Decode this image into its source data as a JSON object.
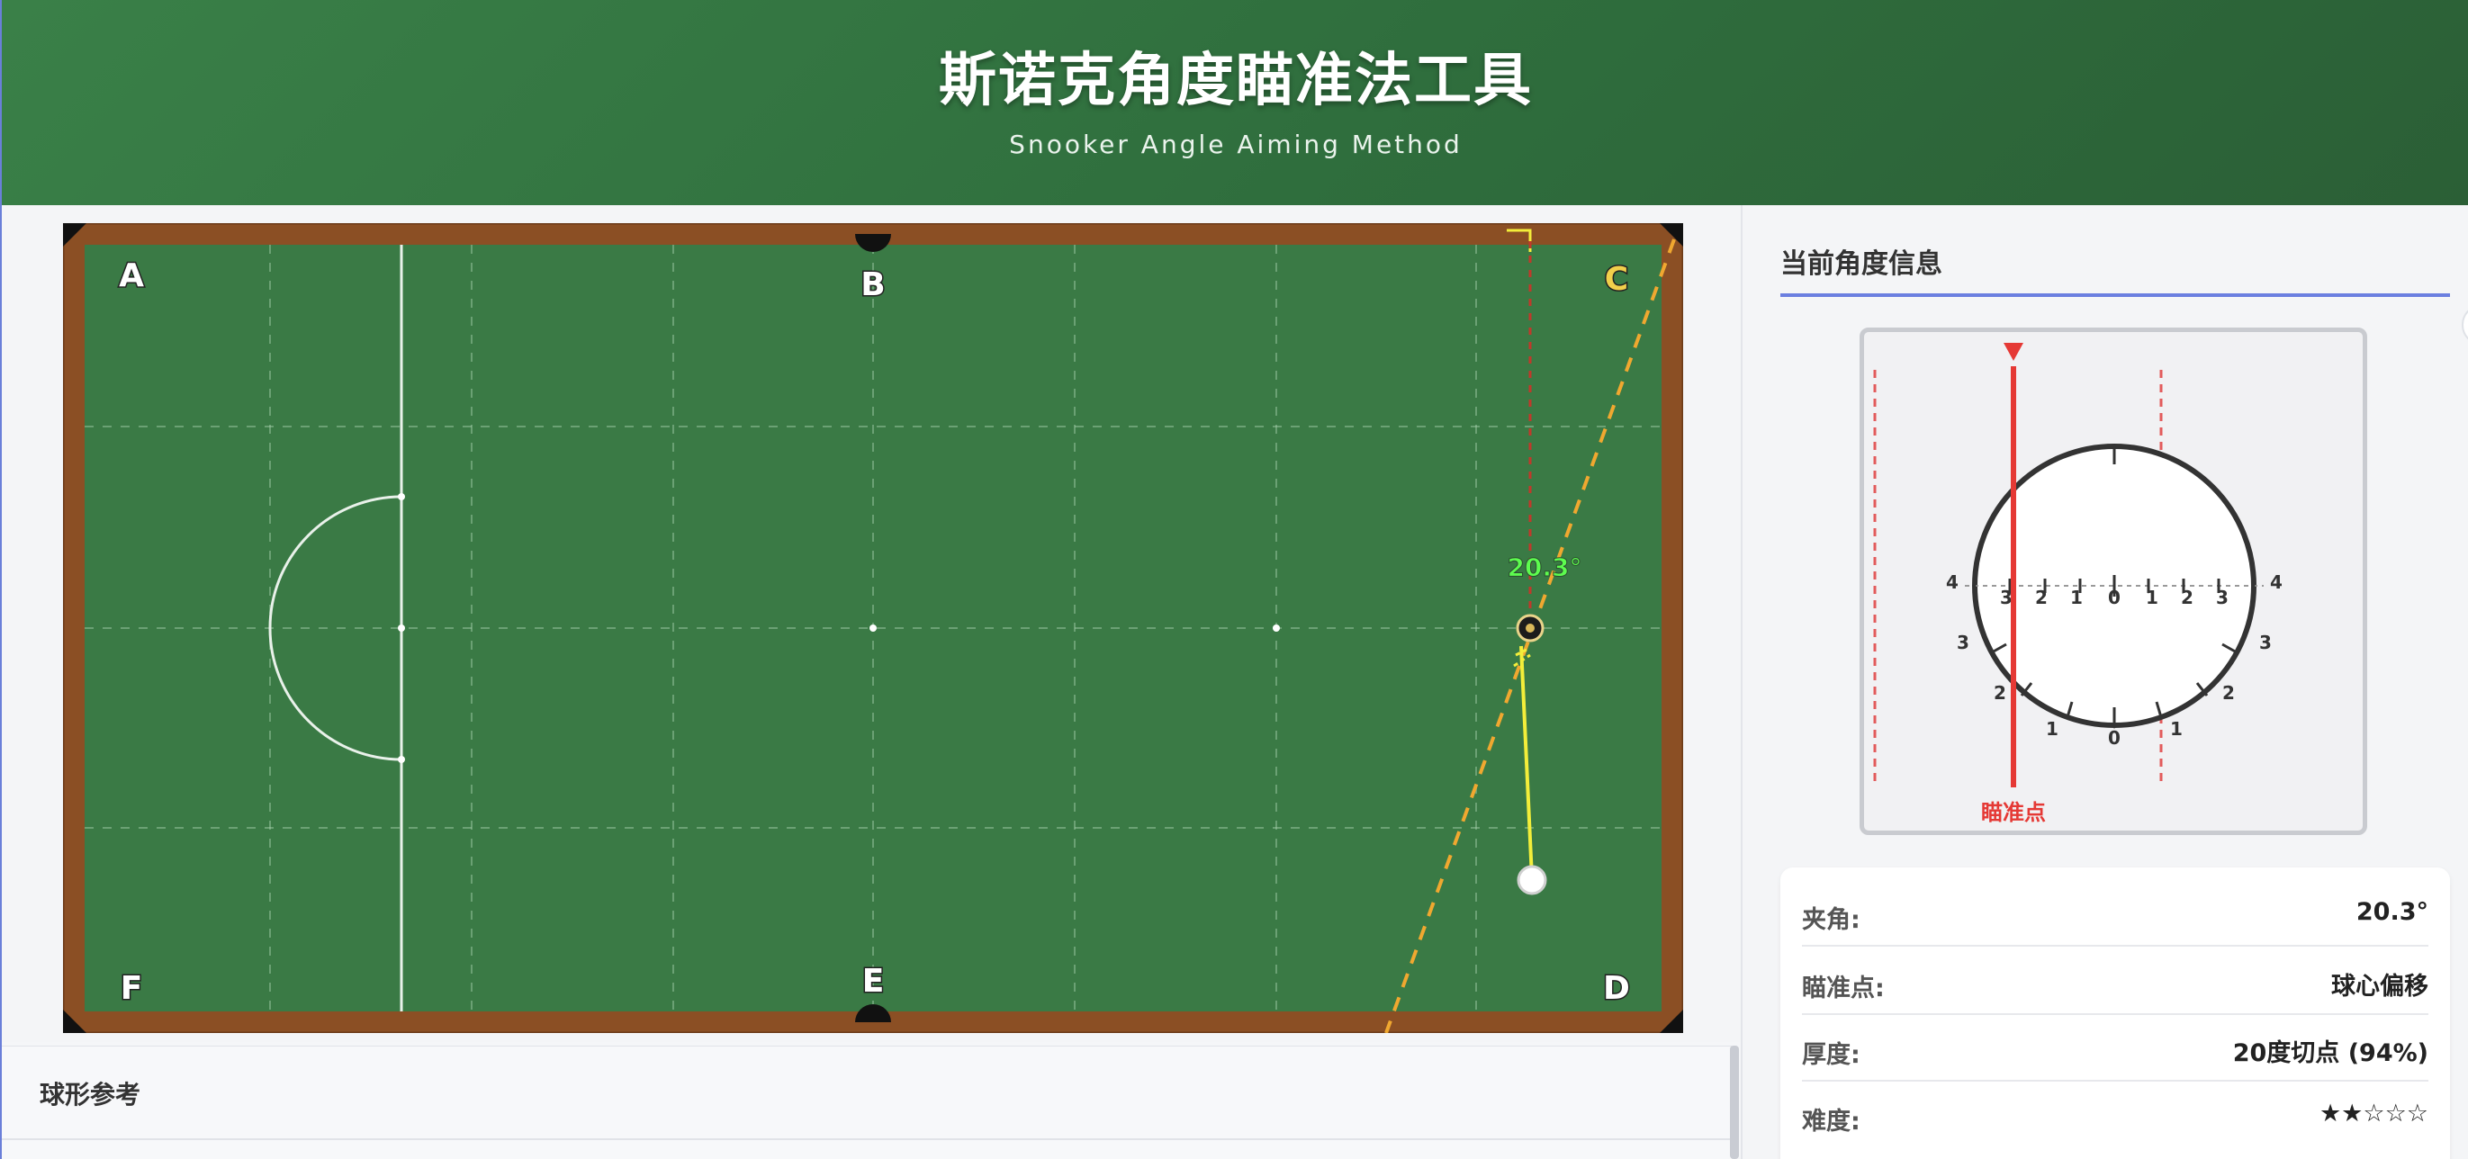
{
  "header": {
    "title": "斯诺克角度瞄准法工具",
    "subtitle": "Snooker Angle Aiming Method"
  },
  "table": {
    "pocket_labels": {
      "A": "A",
      "B": "B",
      "C": "C",
      "D": "D",
      "E": "E",
      "F": "F"
    },
    "highlighted_pocket": "C",
    "angle_label": "20.3°",
    "colors": {
      "cloth": "#3a7a45",
      "cushion": "#8b4f24",
      "aim_line": "#f0a830",
      "cue_line": "#f3ee3a",
      "guide_line": "#c0392b",
      "angle_text": "#5dfc4f"
    }
  },
  "reference": {
    "title": "球形参考"
  },
  "panel": {
    "title": "当前角度信息",
    "gauge": {
      "aim_label": "瞄准点",
      "horizontal_ticks": [
        "4",
        "3",
        "2",
        "1",
        "0",
        "1",
        "2",
        "3",
        "4"
      ],
      "arc_ticks_left": [
        "3",
        "2",
        "1"
      ],
      "arc_ticks_right": [
        "3",
        "2",
        "1"
      ],
      "bottom_tick": "0",
      "aim_color": "#e53935"
    },
    "info": [
      {
        "label": "夹角:",
        "value": "20.3°"
      },
      {
        "label": "瞄准点:",
        "value": "球心偏移"
      },
      {
        "label": "厚度:",
        "value": "20度切点 (94%)"
      },
      {
        "label": "难度:",
        "value": "★★☆☆☆"
      }
    ]
  }
}
